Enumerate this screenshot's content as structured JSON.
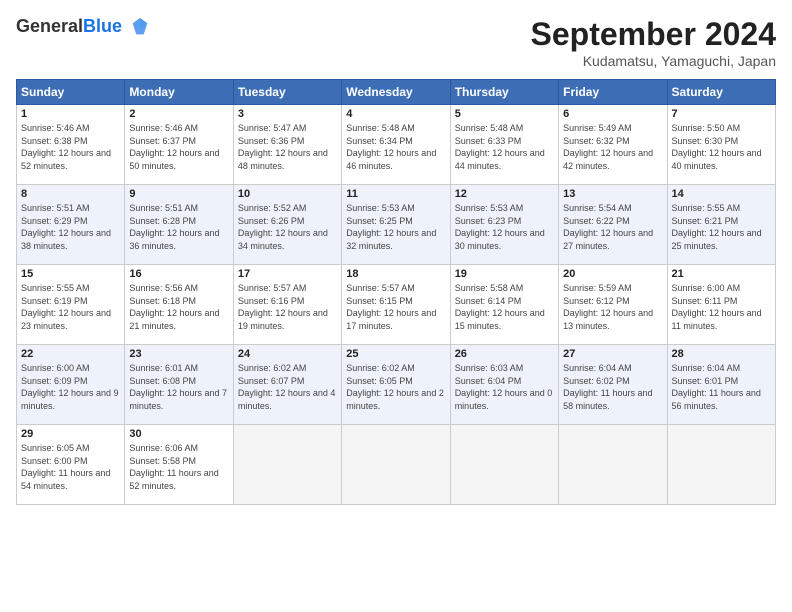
{
  "header": {
    "logo_general": "General",
    "logo_blue": "Blue",
    "month_title": "September 2024",
    "location": "Kudamatsu, Yamaguchi, Japan"
  },
  "weekdays": [
    "Sunday",
    "Monday",
    "Tuesday",
    "Wednesday",
    "Thursday",
    "Friday",
    "Saturday"
  ],
  "weeks": [
    [
      {
        "day": "1",
        "sunrise": "5:46 AM",
        "sunset": "6:38 PM",
        "daylight": "12 hours and 52 minutes."
      },
      {
        "day": "2",
        "sunrise": "5:46 AM",
        "sunset": "6:37 PM",
        "daylight": "12 hours and 50 minutes."
      },
      {
        "day": "3",
        "sunrise": "5:47 AM",
        "sunset": "6:36 PM",
        "daylight": "12 hours and 48 minutes."
      },
      {
        "day": "4",
        "sunrise": "5:48 AM",
        "sunset": "6:34 PM",
        "daylight": "12 hours and 46 minutes."
      },
      {
        "day": "5",
        "sunrise": "5:48 AM",
        "sunset": "6:33 PM",
        "daylight": "12 hours and 44 minutes."
      },
      {
        "day": "6",
        "sunrise": "5:49 AM",
        "sunset": "6:32 PM",
        "daylight": "12 hours and 42 minutes."
      },
      {
        "day": "7",
        "sunrise": "5:50 AM",
        "sunset": "6:30 PM",
        "daylight": "12 hours and 40 minutes."
      }
    ],
    [
      {
        "day": "8",
        "sunrise": "5:51 AM",
        "sunset": "6:29 PM",
        "daylight": "12 hours and 38 minutes."
      },
      {
        "day": "9",
        "sunrise": "5:51 AM",
        "sunset": "6:28 PM",
        "daylight": "12 hours and 36 minutes."
      },
      {
        "day": "10",
        "sunrise": "5:52 AM",
        "sunset": "6:26 PM",
        "daylight": "12 hours and 34 minutes."
      },
      {
        "day": "11",
        "sunrise": "5:53 AM",
        "sunset": "6:25 PM",
        "daylight": "12 hours and 32 minutes."
      },
      {
        "day": "12",
        "sunrise": "5:53 AM",
        "sunset": "6:23 PM",
        "daylight": "12 hours and 30 minutes."
      },
      {
        "day": "13",
        "sunrise": "5:54 AM",
        "sunset": "6:22 PM",
        "daylight": "12 hours and 27 minutes."
      },
      {
        "day": "14",
        "sunrise": "5:55 AM",
        "sunset": "6:21 PM",
        "daylight": "12 hours and 25 minutes."
      }
    ],
    [
      {
        "day": "15",
        "sunrise": "5:55 AM",
        "sunset": "6:19 PM",
        "daylight": "12 hours and 23 minutes."
      },
      {
        "day": "16",
        "sunrise": "5:56 AM",
        "sunset": "6:18 PM",
        "daylight": "12 hours and 21 minutes."
      },
      {
        "day": "17",
        "sunrise": "5:57 AM",
        "sunset": "6:16 PM",
        "daylight": "12 hours and 19 minutes."
      },
      {
        "day": "18",
        "sunrise": "5:57 AM",
        "sunset": "6:15 PM",
        "daylight": "12 hours and 17 minutes."
      },
      {
        "day": "19",
        "sunrise": "5:58 AM",
        "sunset": "6:14 PM",
        "daylight": "12 hours and 15 minutes."
      },
      {
        "day": "20",
        "sunrise": "5:59 AM",
        "sunset": "6:12 PM",
        "daylight": "12 hours and 13 minutes."
      },
      {
        "day": "21",
        "sunrise": "6:00 AM",
        "sunset": "6:11 PM",
        "daylight": "12 hours and 11 minutes."
      }
    ],
    [
      {
        "day": "22",
        "sunrise": "6:00 AM",
        "sunset": "6:09 PM",
        "daylight": "12 hours and 9 minutes."
      },
      {
        "day": "23",
        "sunrise": "6:01 AM",
        "sunset": "6:08 PM",
        "daylight": "12 hours and 7 minutes."
      },
      {
        "day": "24",
        "sunrise": "6:02 AM",
        "sunset": "6:07 PM",
        "daylight": "12 hours and 4 minutes."
      },
      {
        "day": "25",
        "sunrise": "6:02 AM",
        "sunset": "6:05 PM",
        "daylight": "12 hours and 2 minutes."
      },
      {
        "day": "26",
        "sunrise": "6:03 AM",
        "sunset": "6:04 PM",
        "daylight": "12 hours and 0 minutes."
      },
      {
        "day": "27",
        "sunrise": "6:04 AM",
        "sunset": "6:02 PM",
        "daylight": "11 hours and 58 minutes."
      },
      {
        "day": "28",
        "sunrise": "6:04 AM",
        "sunset": "6:01 PM",
        "daylight": "11 hours and 56 minutes."
      }
    ],
    [
      {
        "day": "29",
        "sunrise": "6:05 AM",
        "sunset": "6:00 PM",
        "daylight": "11 hours and 54 minutes."
      },
      {
        "day": "30",
        "sunrise": "6:06 AM",
        "sunset": "5:58 PM",
        "daylight": "11 hours and 52 minutes."
      },
      null,
      null,
      null,
      null,
      null
    ]
  ]
}
